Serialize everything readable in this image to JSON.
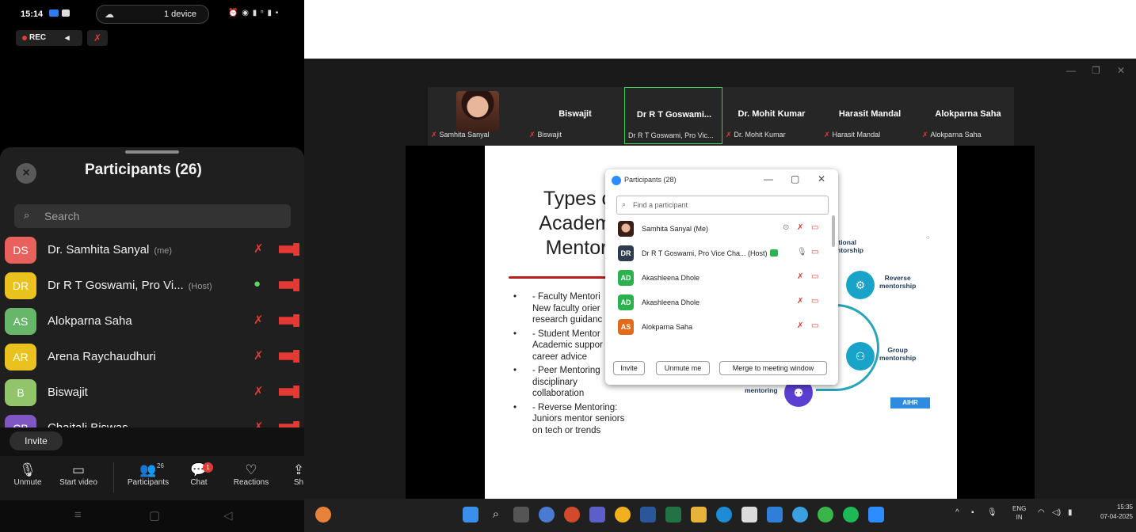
{
  "phone": {
    "status": {
      "time": "15:14",
      "devices": "1 device"
    },
    "rec_label": "REC",
    "panel": {
      "title": "Participants (26)",
      "search_placeholder": "Search",
      "participants": [
        {
          "initials": "DS",
          "name": "Dr. Samhita Sanyal",
          "tag": "(me)",
          "color": "#e8615d",
          "mic": "off"
        },
        {
          "initials": "DR",
          "name": "Dr R T Goswami, Pro Vi...",
          "tag": "(Host)",
          "color": "#e9c21f",
          "mic": "on"
        },
        {
          "initials": "AS",
          "name": "Alokparna Saha",
          "tag": "",
          "color": "#67b66a",
          "mic": "off"
        },
        {
          "initials": "AR",
          "name": "Arena Raychaudhuri",
          "tag": "",
          "color": "#e9c21f",
          "mic": "off"
        },
        {
          "initials": "B",
          "name": "Biswajit",
          "tag": "",
          "color": "#92c46b",
          "mic": "off"
        },
        {
          "initials": "CB",
          "name": "Chaitali Biswas",
          "tag": "",
          "color": "#7e57c2",
          "mic": "off"
        }
      ]
    },
    "invite_label": "Invite",
    "toolbar": {
      "unmute": "Unmute",
      "start_video": "Start video",
      "participants": "Participants",
      "participants_count": "26",
      "chat": "Chat",
      "chat_badge": "1",
      "reactions": "Reactions",
      "share": "Sh"
    }
  },
  "desktop": {
    "video_tiles": [
      {
        "name": "",
        "footer": "Samhita Sanyal",
        "photo": true,
        "active": false
      },
      {
        "name": "Biswajit",
        "footer": "Biswajit",
        "photo": false,
        "active": false
      },
      {
        "name": "Dr R T Goswami...",
        "footer": "Dr R T Goswami, Pro Vic...",
        "photo": false,
        "active": true
      },
      {
        "name": "Dr. Mohit Kumar",
        "footer": "Dr. Mohit Kumar",
        "photo": false,
        "active": false
      },
      {
        "name": "Harasit Mandal",
        "footer": "Harasit Mandal",
        "photo": false,
        "active": false
      },
      {
        "name": "Alokparna Saha",
        "footer": "Alokparna Saha",
        "photo": false,
        "active": false
      }
    ],
    "slide": {
      "title_lines": [
        "Types c",
        "Academ",
        "Mentori"
      ],
      "bullets": [
        [
          "- Faculty Mentori",
          "New faculty orier",
          "research guidanc"
        ],
        [
          "- Student Mentor",
          "Academic suppor",
          "career advice"
        ],
        [
          "- Peer Mentoring",
          "disciplinary",
          "collaboration"
        ],
        [
          "- Reverse Mentoring:",
          "Juniors mentor seniors",
          "on tech or trends"
        ]
      ],
      "diagram_labels": {
        "traditional": "itional\nntorship",
        "reverse": "Reverse\nmentorship",
        "group": "Group\nmentorship",
        "peer": "Peer\nmentoring"
      },
      "brand": "AIHR",
      "circle_color": "#1aa3c8",
      "peer_color": "#5b3fd1"
    },
    "participants_window": {
      "title": "Participants (28)",
      "search_placeholder": "Find a participant",
      "rows": [
        {
          "initials": "",
          "name": "Samhita Sanyal (Me)",
          "photo": true,
          "color": "#3a1f16"
        },
        {
          "initials": "DR",
          "name": "Dr R T Goswami, Pro Vice Cha... (Host)",
          "photo": false,
          "color": "#2f3c4f",
          "host": true
        },
        {
          "initials": "AD",
          "name": "Akashleena Dhole",
          "photo": false,
          "color": "#2bb24c"
        },
        {
          "initials": "AD",
          "name": "Akashleena Dhole",
          "photo": false,
          "color": "#2bb24c"
        },
        {
          "initials": "AS",
          "name": "Alokparna Saha",
          "photo": false,
          "color": "#e26a1b"
        }
      ],
      "buttons": {
        "invite": "Invite",
        "unmute": "Unmute me",
        "merge": "Merge to meeting window"
      }
    },
    "taskbar": {
      "lang_top": "ENG",
      "lang_bottom": "IN",
      "time": "15:35",
      "date": "07-04-2025"
    }
  }
}
